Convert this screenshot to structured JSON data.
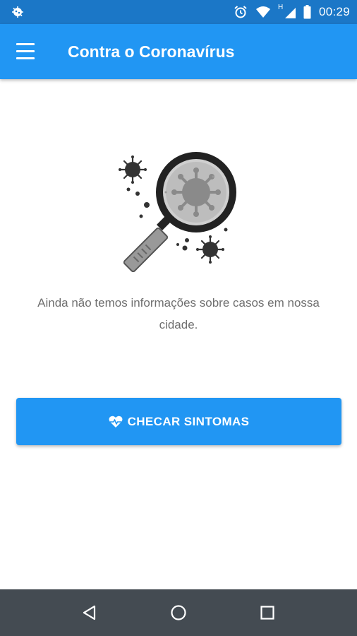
{
  "status_bar": {
    "time": "00:29",
    "left_icon": "app-notification-icon",
    "icons": [
      "alarm-icon",
      "wifi-icon",
      "signal-icon",
      "battery-icon"
    ],
    "network_label": "H"
  },
  "app_bar": {
    "title": "Contra o Coronavírus",
    "menu_icon": "hamburger-menu-icon",
    "color": "#2196f3"
  },
  "main": {
    "illustration": "magnifier-virus-illustration",
    "message": "Ainda não temos informações sobre casos em nossa cidade.",
    "action_button": {
      "label": "CHECAR SINTOMAS",
      "icon": "heart-pulse-icon",
      "color": "#2196f3"
    }
  },
  "nav_bar": {
    "buttons": [
      "back-icon",
      "home-icon",
      "recents-icon"
    ]
  }
}
